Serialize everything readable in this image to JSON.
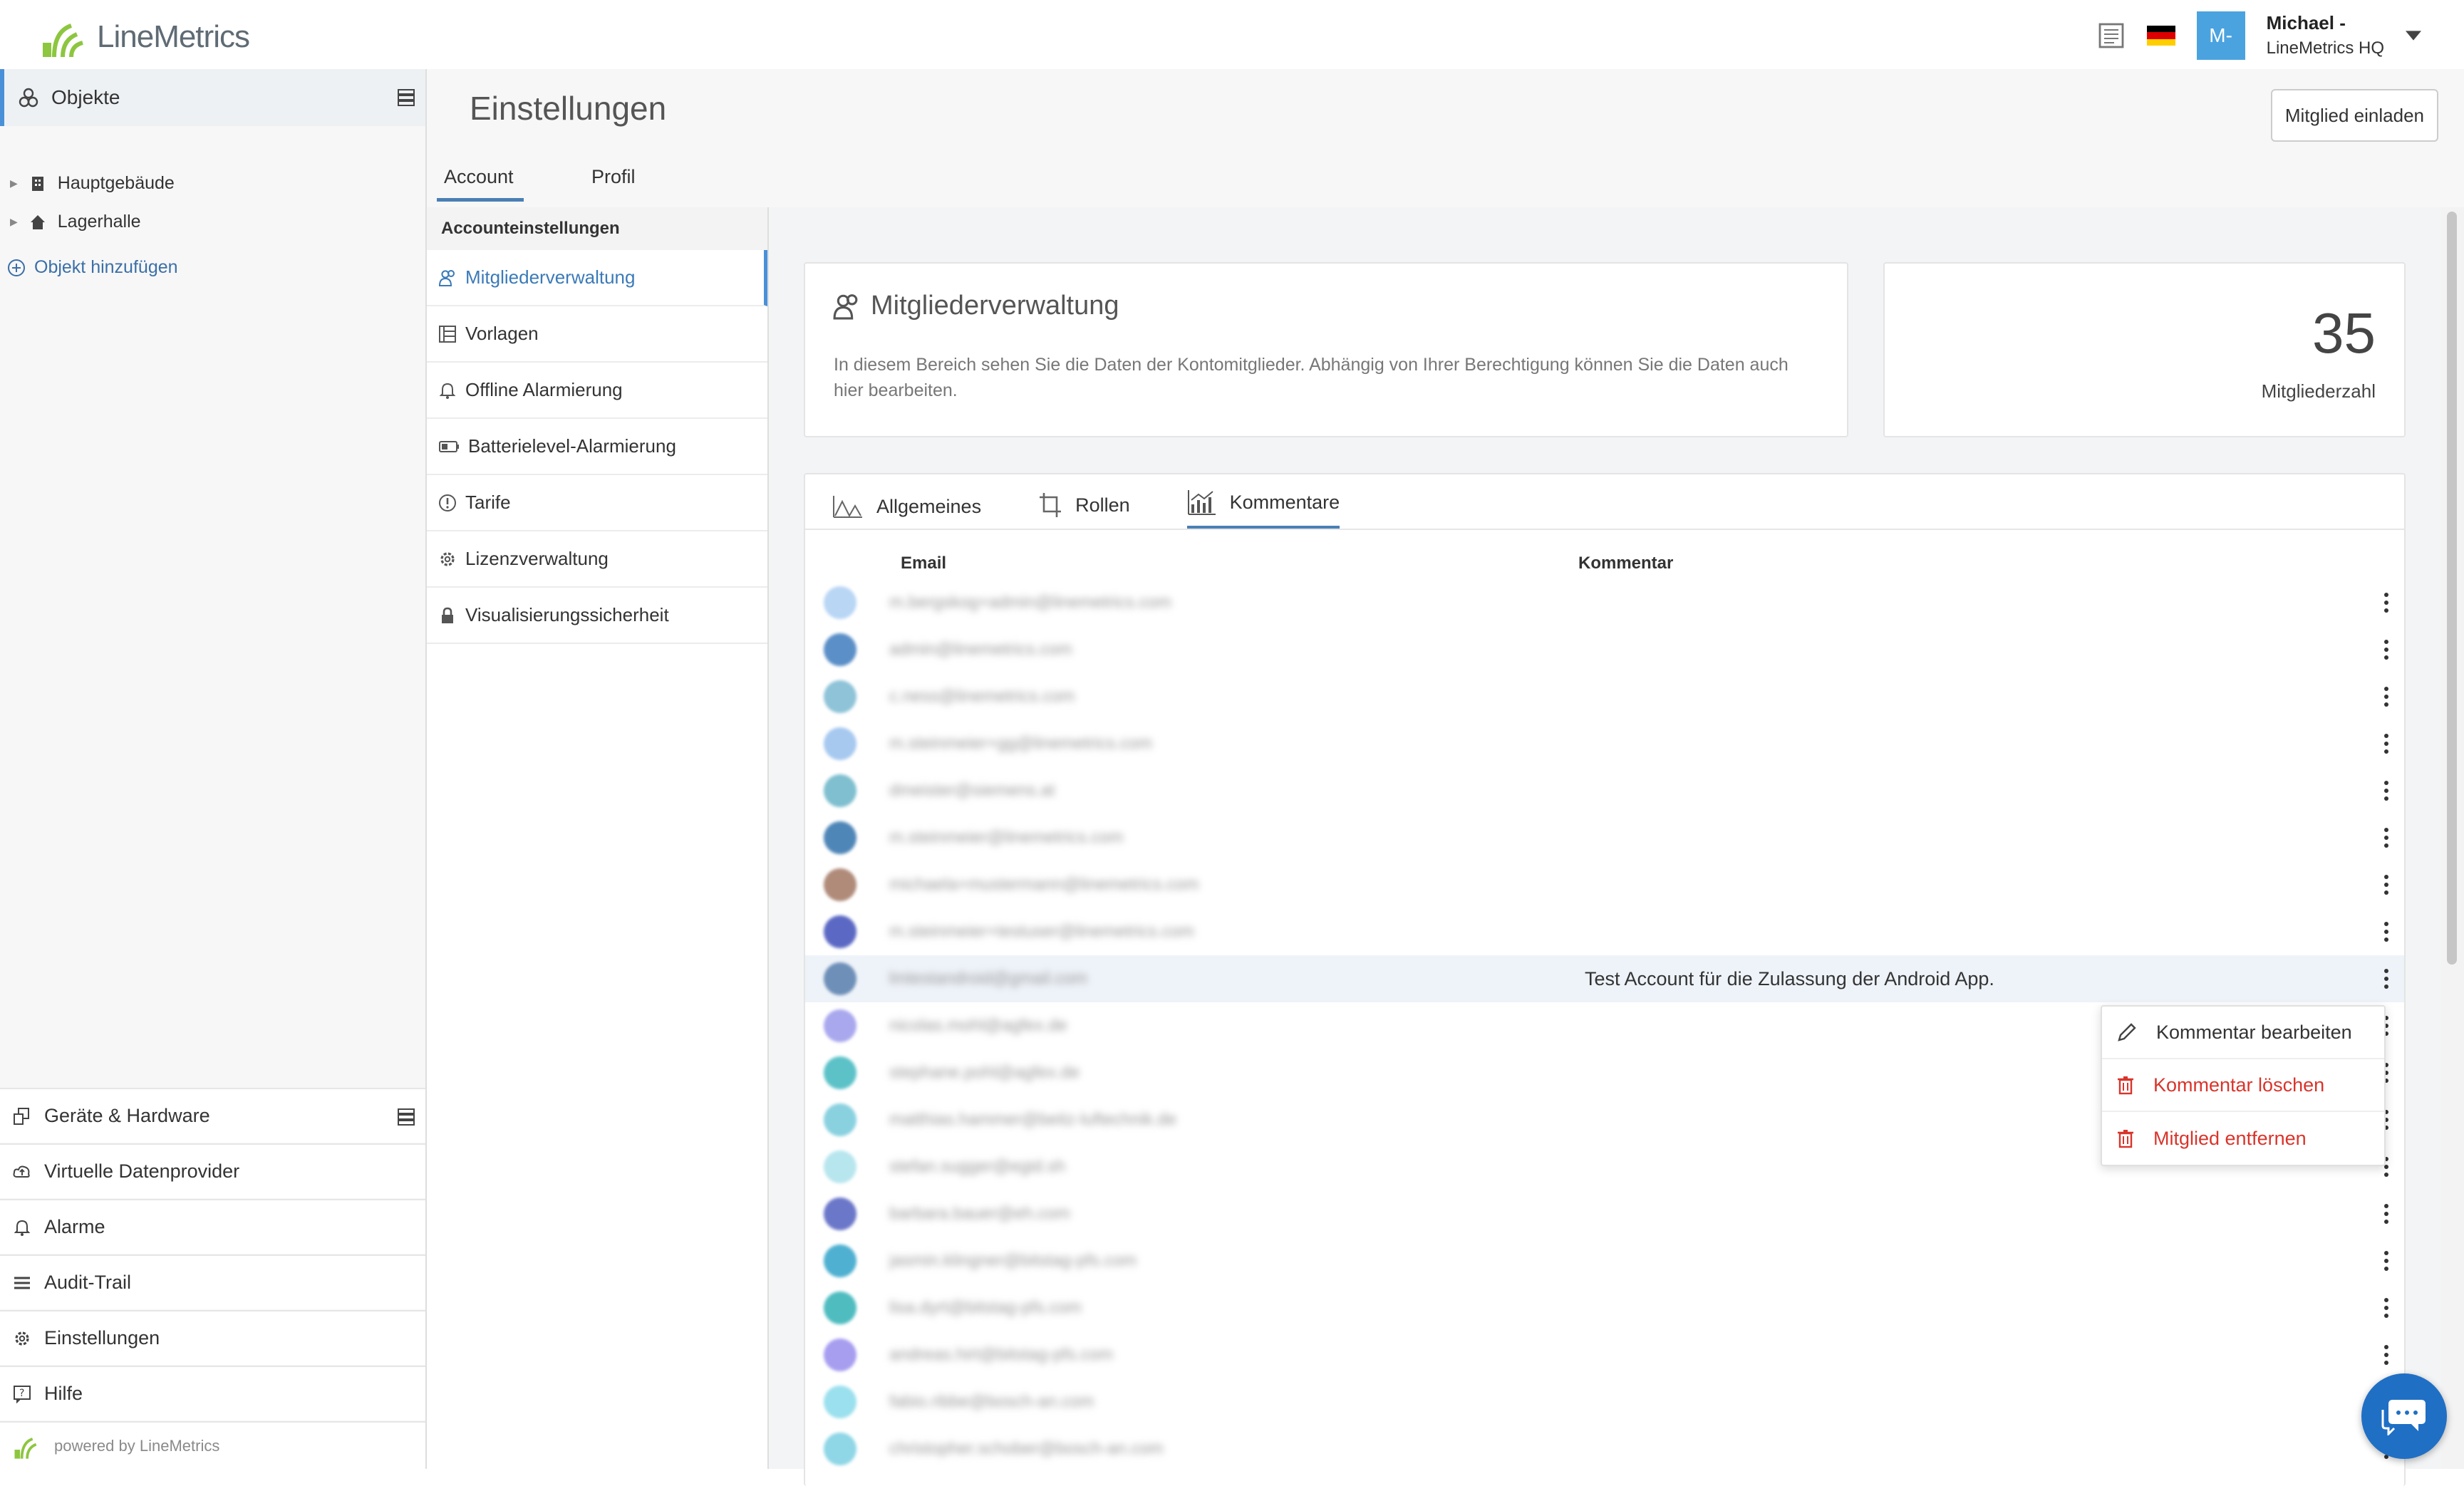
{
  "app": {
    "brand": "LineMetrics",
    "accent": "#4a90d9"
  },
  "topbar": {
    "user_initials": "M-",
    "user_name": "Michael -",
    "user_org": "LineMetrics HQ",
    "icons": [
      "news-icon",
      "flag-de-icon",
      "chevron-down-icon"
    ]
  },
  "sidebar": {
    "objects_label": "Objekte",
    "tree": [
      {
        "label": "Hauptgebäude",
        "icon": "building-icon"
      },
      {
        "label": "Lagerhalle",
        "icon": "home-icon"
      }
    ],
    "add_object": "Objekt hinzufügen",
    "bottom": [
      {
        "label": "Geräte & Hardware",
        "icon": "device-icon"
      },
      {
        "label": "Virtuelle Datenprovider",
        "icon": "cloud-upload-icon"
      },
      {
        "label": "Alarme",
        "icon": "bell-icon"
      },
      {
        "label": "Audit-Trail",
        "icon": "list-icon"
      },
      {
        "label": "Einstellungen",
        "icon": "gear-icon"
      },
      {
        "label": "Hilfe",
        "icon": "help-icon"
      }
    ],
    "powered": "powered by LineMetrics"
  },
  "header": {
    "title": "Einstellungen",
    "invite": "Mitglied einladen",
    "tabs": [
      "Account",
      "Profil"
    ]
  },
  "settings_nav": {
    "heading": "Accounteinstellungen",
    "items": [
      {
        "label": "Mitgliederverwaltung",
        "icon": "members-icon"
      },
      {
        "label": "Vorlagen",
        "icon": "template-icon"
      },
      {
        "label": "Offline Alarmierung",
        "icon": "bell-icon"
      },
      {
        "label": "Batterielevel-Alarmierung",
        "icon": "battery-icon"
      },
      {
        "label": "Tarife",
        "icon": "info-circle-icon"
      },
      {
        "label": "Lizenzverwaltung",
        "icon": "gear-icon"
      },
      {
        "label": "Visualisierungssicherheit",
        "icon": "lock-icon"
      }
    ]
  },
  "members_card": {
    "title": "Mitgliederverwaltung",
    "description": "In diesem Bereich sehen Sie die Daten der Kontomitglieder. Abhängig von Ihrer Berechtigung können Sie die Daten auch hier bearbeiten."
  },
  "count_card": {
    "value": "35",
    "label": "Mitgliederzahl"
  },
  "member_tabs": [
    {
      "label": "Allgemeines",
      "icon": "chart-area-icon"
    },
    {
      "label": "Rollen",
      "icon": "crop-icon"
    },
    {
      "label": "Kommentare",
      "icon": "chart-bar-icon"
    }
  ],
  "table": {
    "col_email": "Email",
    "col_comment": "Kommentar",
    "rows": [
      {
        "email": "m.bergskog+admin@linemetrics.com",
        "comment": "",
        "avatar": "#b9d6f5"
      },
      {
        "email": "admin@linemetrics.com",
        "comment": "",
        "avatar": "#5b8fc7"
      },
      {
        "email": "c.ness@linemetrics.com",
        "comment": "",
        "avatar": "#8ec3d8"
      },
      {
        "email": "m.steinmeier+gg@linemetrics.com",
        "comment": "",
        "avatar": "#a7c9f0"
      },
      {
        "email": "dmeister@siemens.at",
        "comment": "",
        "avatar": "#7fbfcf"
      },
      {
        "email": "m.steinmeier@linemetrics.com",
        "comment": "",
        "avatar": "#4f86b8"
      },
      {
        "email": "michaela+mustermann@linemetrics.com",
        "comment": "",
        "avatar": "#b08b7a"
      },
      {
        "email": "m.steinmeier+testuser@linemetrics.com",
        "comment": "",
        "avatar": "#5c69c4"
      },
      {
        "email": "lmtestandroid@gmail.com",
        "comment": "Test Account für die Zulassung der Android App.",
        "avatar": "#6e8fb8"
      },
      {
        "email": "nicolas.mohl@agfex.de",
        "comment": "",
        "avatar": "#a9a8ee"
      },
      {
        "email": "stephane.pohl@agfex.de",
        "comment": "",
        "avatar": "#5cc2c8"
      },
      {
        "email": "matthias.hammer@beitz-luftechnik.de",
        "comment": "",
        "avatar": "#8ad1e0"
      },
      {
        "email": "stefan.sugger@egid.sh",
        "comment": "",
        "avatar": "#b8e6ee"
      },
      {
        "email": "barbara.bauer@eh.com",
        "comment": "",
        "avatar": "#6b77c9"
      },
      {
        "email": "jasmin.klingner@bitstag-pfs.com",
        "comment": "",
        "avatar": "#4fb0d1"
      },
      {
        "email": "lisa.dyrt@bitstag-pfs.com",
        "comment": "",
        "avatar": "#4fbcc0"
      },
      {
        "email": "andreas.hirt@bitstag-pfs.com",
        "comment": "",
        "avatar": "#a79ef0"
      },
      {
        "email": "fabio.ribbe@bosch-an.com",
        "comment": "",
        "avatar": "#9be0ee"
      },
      {
        "email": "christopher.schober@bosch-an.com",
        "comment": "",
        "avatar": "#8fd6e6"
      }
    ]
  },
  "context_menu": {
    "edit": "Kommentar bearbeiten",
    "delete": "Kommentar löschen",
    "remove": "Mitglied entfernen",
    "danger_color": "#d9342b"
  }
}
